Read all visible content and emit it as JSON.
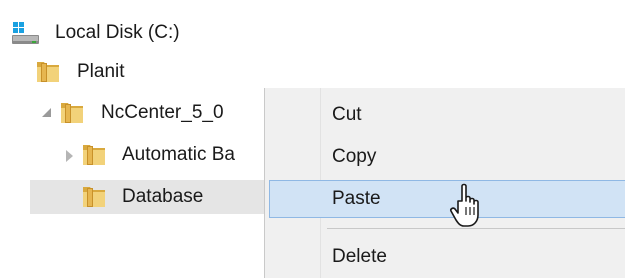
{
  "tree": {
    "drive": {
      "label": "Local Disk (C:)",
      "icon": "drive-icon"
    },
    "items": [
      {
        "label": "Planit",
        "icon": "folder-icon"
      },
      {
        "label": "NcCenter_5_0",
        "icon": "folder-icon",
        "expander": "expanded"
      },
      {
        "label": "Automatic Ba",
        "icon": "folder-icon",
        "expander": "collapsed"
      },
      {
        "label": "Database",
        "icon": "folder-icon",
        "selected": true
      }
    ]
  },
  "context_menu": {
    "items": [
      {
        "label": "Cut"
      },
      {
        "label": "Copy"
      },
      {
        "label": "Paste",
        "highlighted": true
      },
      {
        "label": "Delete"
      }
    ]
  },
  "colors": {
    "folder_front": "#e8c56a",
    "folder_back": "#d9a93e",
    "menu_highlight": "#d1e3f5",
    "menu_highlight_border": "#8fb8e4",
    "drive_accent": "#1aa1e1"
  },
  "cursor": "hand-pointer-icon"
}
